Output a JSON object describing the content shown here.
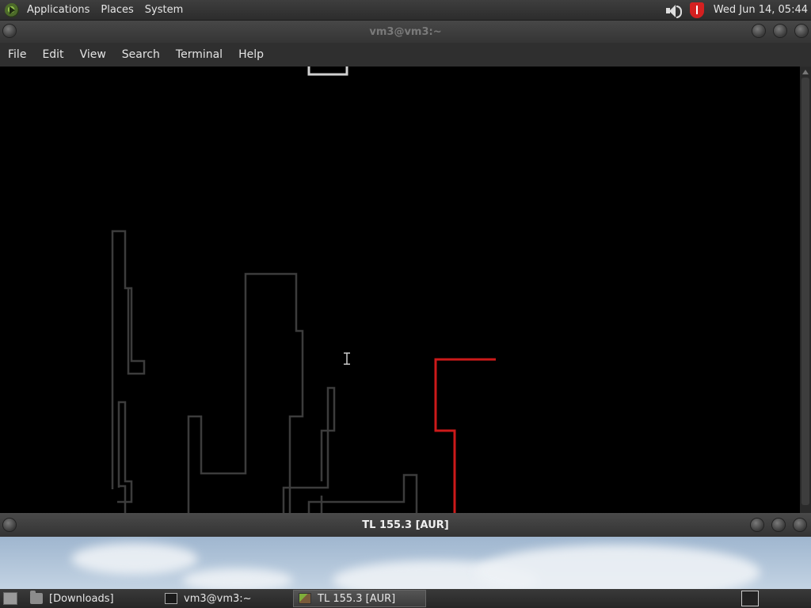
{
  "top_panel": {
    "menus": [
      "Applications",
      "Places",
      "System"
    ],
    "clock": "Wed Jun 14, 05:44",
    "icons": [
      "distro-logo-icon",
      "speaker-icon",
      "shield-icon"
    ]
  },
  "terminal_window": {
    "title": "vm3@vm3:~",
    "menu": [
      "File",
      "Edit",
      "View",
      "Search",
      "Terminal",
      "Help"
    ]
  },
  "fg_window": {
    "title": "TL 155.3 [AUR]"
  },
  "taskbar": {
    "tasks": [
      {
        "label": "[Downloads]",
        "icon": "folder-icon"
      },
      {
        "label": "vm3@vm3:~",
        "icon": "terminal-icon"
      },
      {
        "label": "TL 155.3 [AUR]",
        "icon": "cube-icon"
      }
    ]
  },
  "colors": {
    "terminal_bg": "#000000",
    "line_gray": "#3c3c3c",
    "line_red": "#cc1a1a",
    "cursor_box": "#d0d0d0"
  }
}
